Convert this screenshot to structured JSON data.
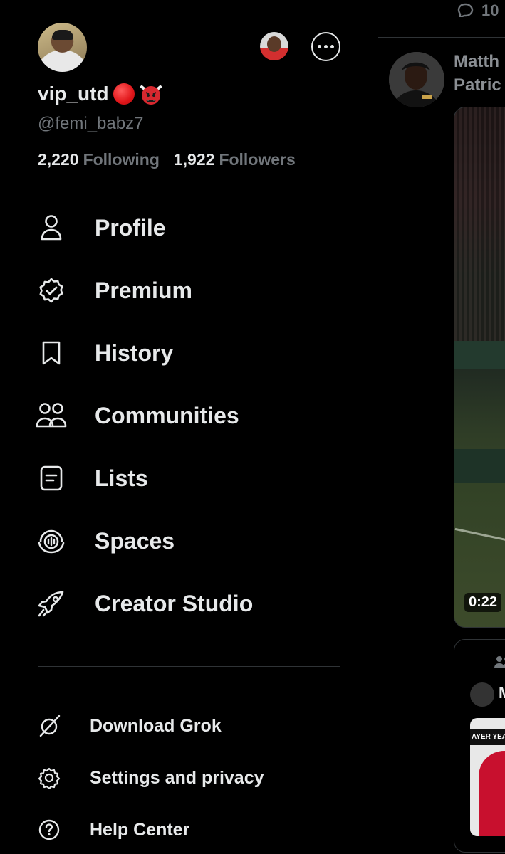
{
  "profile": {
    "display_name": "vip_utd",
    "handle": "@femi_babz7",
    "following_count": "2,220",
    "following_label": "Following",
    "followers_count": "1,922",
    "followers_label": "Followers"
  },
  "nav": {
    "items": [
      {
        "label": "Profile",
        "icon": "person-icon"
      },
      {
        "label": "Premium",
        "icon": "verified-badge-icon"
      },
      {
        "label": "History",
        "icon": "bookmark-icon"
      },
      {
        "label": "Communities",
        "icon": "communities-icon"
      },
      {
        "label": "Lists",
        "icon": "list-icon"
      },
      {
        "label": "Spaces",
        "icon": "spaces-icon"
      },
      {
        "label": "Creator Studio",
        "icon": "rocket-icon"
      }
    ]
  },
  "secondary": {
    "items": [
      {
        "label": "Download Grok",
        "icon": "grok-icon"
      },
      {
        "label": "Settings and privacy",
        "icon": "gear-icon"
      },
      {
        "label": "Help Center",
        "icon": "help-icon"
      }
    ]
  },
  "timeline": {
    "reply_count": "10",
    "post_author": "Matth\nPatric",
    "video_duration": "0:22",
    "quote_author": "M",
    "quote_banner": "AYER YEAR"
  },
  "colors": {
    "background": "#000000",
    "text_primary": "#e7e9ea",
    "text_secondary": "#71767b",
    "divider": "#2f3336"
  }
}
